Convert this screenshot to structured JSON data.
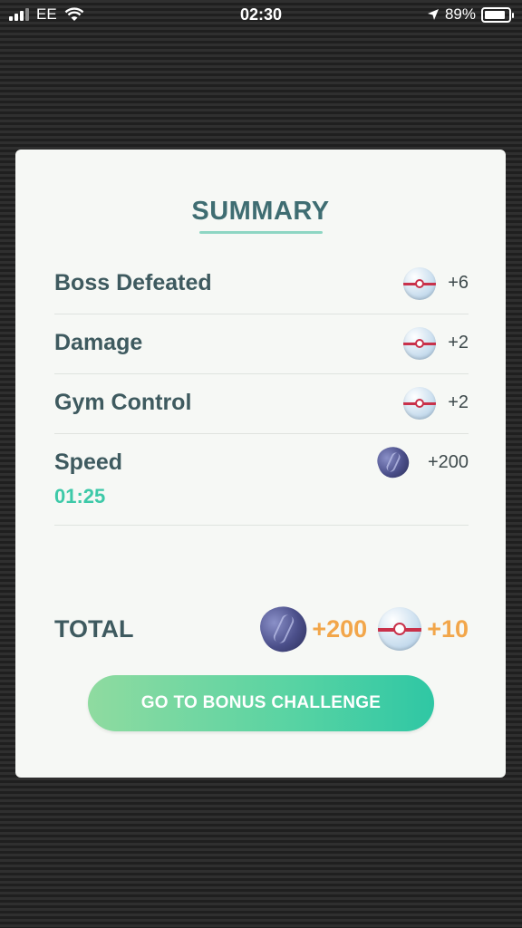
{
  "status_bar": {
    "carrier": "EE",
    "time": "02:30",
    "battery": "89%",
    "battery_level": 0.89
  },
  "summary": {
    "title": "SUMMARY",
    "rows": [
      {
        "label": "Boss Defeated",
        "reward": "+6",
        "icon": "premier-ball-icon"
      },
      {
        "label": "Damage",
        "reward": "+2",
        "icon": "premier-ball-icon"
      },
      {
        "label": "Gym Control",
        "reward": "+2",
        "icon": "premier-ball-icon"
      },
      {
        "label": "Speed",
        "time": "01:25",
        "reward": "+200",
        "icon": "rare-candy-icon"
      }
    ],
    "total": {
      "label": "TOTAL",
      "candy": "+200",
      "balls": "+10"
    },
    "button_label": "GO TO BONUS CHALLENGE"
  },
  "colors": {
    "title": "#3f6d72",
    "accent": "#3dc9a8",
    "total_value": "#f2a64a"
  }
}
